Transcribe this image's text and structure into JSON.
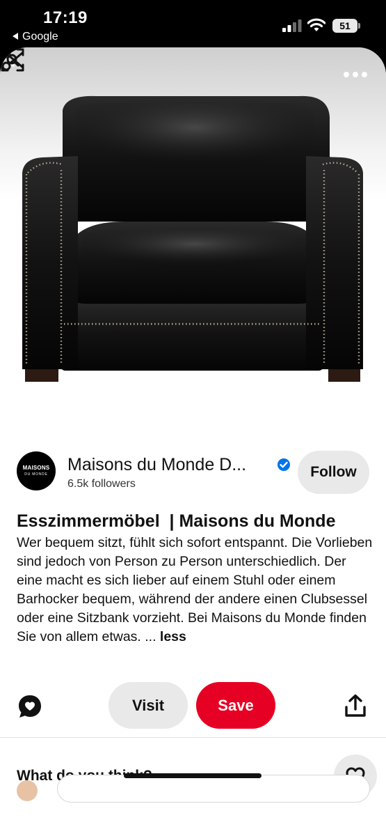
{
  "status_bar": {
    "time": "17:19",
    "back_app": "Google",
    "battery": "51",
    "icons": [
      "signal-icon",
      "wifi-icon",
      "battery-icon"
    ]
  },
  "pin": {
    "image_subject": "black leather club armchair",
    "nav_icons": [
      "back-chevron-icon",
      "more-icon"
    ],
    "image_tools": [
      "visual-search-icon",
      "scissors-icon"
    ]
  },
  "creator": {
    "logo_line1": "MAISONS",
    "logo_line2": "DU MONDE",
    "name": "Maisons du Monde D...",
    "verified_icon": "verified-badge-icon",
    "followers": "6.5k followers",
    "follow_label": "Follow"
  },
  "content": {
    "title": "Esszimmermöbel  | Maisons du Monde",
    "description": "Wer bequem sitzt, fühlt sich sofort entspannt. Die Vorlieben sind jedoch von Person zu Person unterschiedlich. Der eine macht es sich lieber auf einem Stuhl oder einem Barhocker bequem, während der andere einen Clubsessel oder eine Sitzbank vorzieht. Bei Maisons du Monde finden Sie von allem etwas. ... ",
    "less_label": "less"
  },
  "actions": {
    "visit_label": "Visit",
    "save_label": "Save",
    "icons": [
      "comment-icon",
      "share-icon"
    ]
  },
  "feedback": {
    "question": "What do you think?",
    "icon": "heart-icon"
  },
  "colors": {
    "save_red": "#e60023",
    "verified_blue": "#0074e8",
    "pill_gray": "#e9e9e9"
  }
}
